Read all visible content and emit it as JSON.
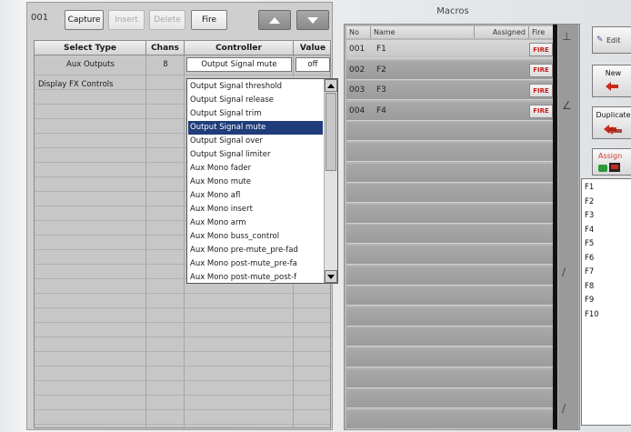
{
  "toolbar": {
    "id": "001",
    "capture": "Capture",
    "insert": "Insert",
    "delete": "Delete",
    "fire": "Fire"
  },
  "grid": {
    "headers": [
      "Select Type",
      "Chans",
      "Controller",
      "Value"
    ],
    "rows": [
      {
        "select_type": "Aux Outputs",
        "chans": "8",
        "controller": "Output Signal mute",
        "value": "off"
      },
      {
        "select_type": "Display FX Controls",
        "chans": "",
        "controller": "",
        "value": ""
      }
    ]
  },
  "dropdown": {
    "selected": "Output Signal mute",
    "options": [
      "Output Signal threshold",
      "Output Signal release",
      "Output Signal trim",
      "Output Signal mute",
      "Output Signal over",
      "Output Signal limiter",
      "Aux Mono fader",
      "Aux Mono mute",
      "Aux Mono afl",
      "Aux Mono insert",
      "Aux Mono arm",
      "Aux Mono buss_control",
      "Aux Mono pre-mute_pre-fad",
      "Aux Mono post-mute_pre-fa",
      "Aux Mono post-mute_post-f"
    ]
  },
  "macros": {
    "title": "Macros",
    "headers": {
      "no": "No",
      "name": "Name",
      "assigned": "Assigned",
      "fire": "Fire"
    },
    "rows": [
      {
        "no": "001",
        "name": "F1",
        "fire": "FIRE"
      },
      {
        "no": "002",
        "name": "F2",
        "fire": "FIRE"
      },
      {
        "no": "003",
        "name": "F3",
        "fire": "FIRE"
      },
      {
        "no": "004",
        "name": "F4",
        "fire": "FIRE"
      }
    ]
  },
  "side": {
    "edit": "Edit",
    "new": "New",
    "duplicate": "Duplicate",
    "assign": "Assign"
  },
  "macro_list": [
    "F1",
    "F2",
    "F3",
    "F4",
    "F5",
    "F6",
    "F7",
    "F8",
    "F9",
    "F10"
  ],
  "colors": {
    "fire_text": "#c81e1e",
    "selection": "#1f3d7a",
    "red_arrow": "#cc2a1a",
    "green_icon": "#2a9a3a"
  }
}
